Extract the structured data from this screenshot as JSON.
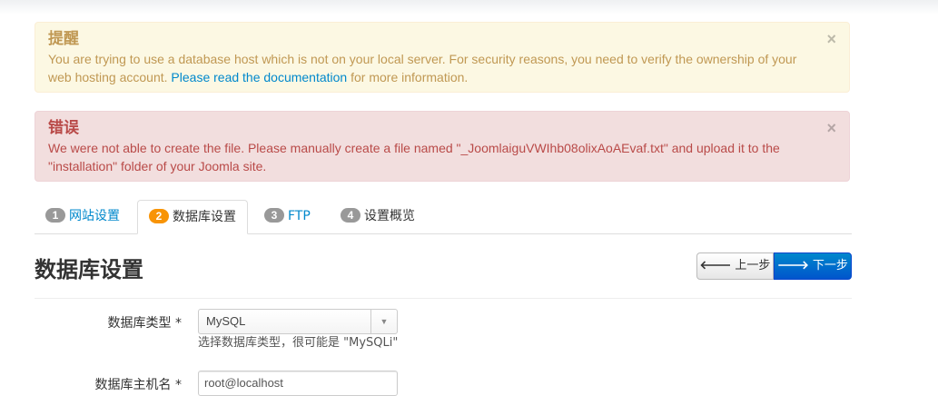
{
  "warning": {
    "heading": "提醒",
    "text_before": "You are trying to use a database host which is not on your local server. For security reasons, you need to verify the ownership of your web hosting account. ",
    "link": "Please read the documentation",
    "text_after": " for more information.",
    "close": "×"
  },
  "error": {
    "heading": "错误",
    "text": "We were not able to create the file. Please manually create a file named \"_JoomlaiguVWIhb08olixAoAEvaf.txt\" and upload it to the \"installation\" folder of your Joomla site.",
    "close": "×"
  },
  "tabs": [
    {
      "num": "1",
      "label": "网站设置"
    },
    {
      "num": "2",
      "label": "数据库设置"
    },
    {
      "num": "3",
      "label": "FTP"
    },
    {
      "num": "4",
      "label": "设置概览"
    }
  ],
  "page_title": "数据库设置",
  "buttons": {
    "prev": "上一步",
    "next": "下一步"
  },
  "form": {
    "db_type_label": "数据库类型 *",
    "db_type_value": "MySQL",
    "db_type_help": "选择数据库类型，很可能是 \"MySQLi\"",
    "db_host_label": "数据库主机名 *",
    "db_host_value": "root@localhost"
  },
  "colors": {
    "accent": "#0088cc",
    "warning_bg": "#fcf8e3",
    "error_bg": "#f2dede",
    "active_badge": "#f89406"
  }
}
